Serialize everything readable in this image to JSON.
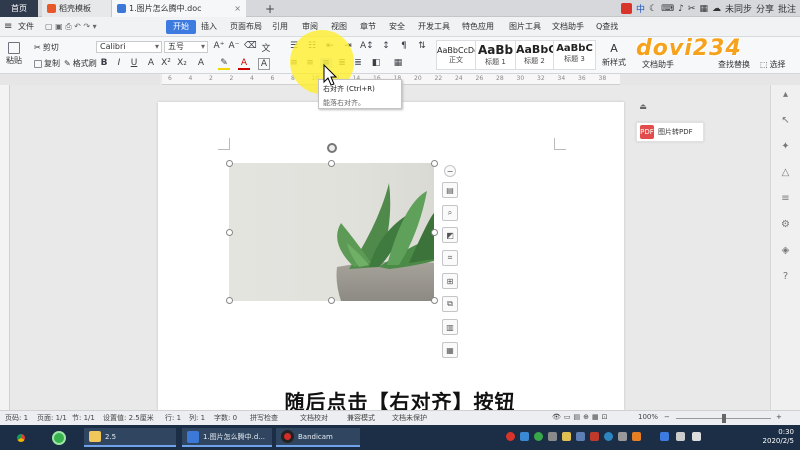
{
  "tabs": {
    "home": "首页",
    "template": "稻壳模板",
    "document": "1.图片怎么腾中.doc",
    "add": "+"
  },
  "top_tray": {
    "ime": "中",
    "sync": "未同步",
    "share": "分享",
    "comment": "批注"
  },
  "menu": {
    "file": "文件",
    "items": [
      "开始",
      "插入",
      "页面布局",
      "引用",
      "审阅",
      "视图",
      "章节",
      "安全",
      "开发工具",
      "特色应用",
      "图片工具",
      "文档助手"
    ],
    "search": "Q查找"
  },
  "ribbon": {
    "cut": "剪切",
    "paste": "粘贴",
    "copy": "复制",
    "format_painter": "格式刷",
    "font_name": "Calibri",
    "font_size": "五号",
    "styles": [
      {
        "preview": "AaBbCcDd",
        "name": "正文"
      },
      {
        "preview": "AaBb",
        "name": "标题 1"
      },
      {
        "preview": "AaBbC",
        "name": "标题 2"
      },
      {
        "preview": "AaBbC",
        "name": "标题 3"
      }
    ],
    "new_style": "新样式",
    "assistant": "文档助手",
    "find_replace": "查找替换",
    "select": "选择"
  },
  "ruler_ticks": [
    "6",
    "4",
    "2",
    "2",
    "4",
    "6",
    "8",
    "10",
    "12",
    "14",
    "16",
    "18",
    "20",
    "22",
    "24",
    "26",
    "28",
    "30",
    "32",
    "34",
    "36",
    "38"
  ],
  "tooltip": {
    "title": "右对齐 (Ctrl+R)",
    "desc": "能落右对齐。"
  },
  "right_panel": {
    "to_pdf": "图片转PDF",
    "pdf_badge": "PDF"
  },
  "watermark": "dovi234",
  "subtitle": "随后点击【右对齐】按钮",
  "status": {
    "page_num": "页码: 1",
    "pages": "页面: 1/1",
    "section": "节: 1/1",
    "position": "设置值: 2.5厘米",
    "line": "行: 1",
    "col": "列: 1",
    "words": "字数: 0",
    "spell": "拼写检查",
    "proof": "文档校对",
    "compat": "兼容模式",
    "protect": "文档未保护",
    "zoom": "100%"
  },
  "taskbar": {
    "folder": "2.5",
    "wps": "1.图片怎么腾中.d...",
    "bandicam": "Bandicam",
    "time": "0:30",
    "date": "2020/2/5"
  },
  "colors": {
    "accent": "#3d7be0",
    "highlight": "#ffee28",
    "pdf": "#e24c4b",
    "taskbar": "#1b2e45"
  }
}
